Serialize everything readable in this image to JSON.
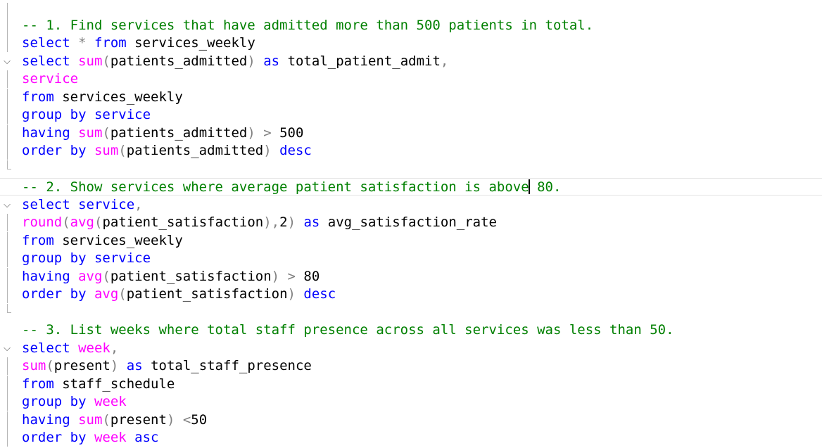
{
  "editor": {
    "colors": {
      "keyword": "#0000ff",
      "function": "#ff00ff",
      "comment": "#008000",
      "operator": "#808080"
    },
    "query1": {
      "comment": "-- 1. Find services that have admitted more than 500 patients in total.",
      "l1": {
        "kw1": "select",
        "op": " * ",
        "kw2": "from",
        "rest": " services_weekly"
      },
      "l2": {
        "kw": "select",
        "fn": "sum",
        "p1": "(",
        "arg": "patients_admitted",
        "p2": ")",
        "kw2": " as",
        "alias": " total_patient_admit",
        "comma": ","
      },
      "l3": {
        "fn": "service"
      },
      "l4": {
        "kw": "from",
        "rest": " services_weekly"
      },
      "l5": {
        "kw": "group by",
        "fn": " service"
      },
      "l6": {
        "kw": "having",
        "fn": " sum",
        "p1": "(",
        "arg": "patients_admitted",
        "p2": ")",
        "op": " > ",
        "num": "500"
      },
      "l7": {
        "kw": "order by",
        "fn": " sum",
        "p1": "(",
        "arg": "patients_admitted",
        "p2": ")",
        "kw2": " desc"
      }
    },
    "query2": {
      "comment_a": "-- 2. Show services where average patient satisfaction is above",
      "comment_b": " 80.",
      "l1": {
        "kw": "select",
        "fn": " service",
        "comma": ","
      },
      "l2": {
        "fn1": "round",
        "p1": "(",
        "fn2": "avg",
        "p2": "(",
        "arg": "patient_satisfaction",
        "p3": "),",
        "num": "2",
        "p4": ")",
        "kw": " as",
        "alias": " avg_satisfaction_rate"
      },
      "l3": {
        "kw": "from",
        "rest": " services_weekly"
      },
      "l4": {
        "kw": "group by",
        "fn": " service"
      },
      "l5": {
        "kw": "having",
        "fn": " avg",
        "p1": "(",
        "arg": "patient_satisfaction",
        "p2": ")",
        "op": " > ",
        "num": "80"
      },
      "l6": {
        "kw": "order by",
        "fn": " avg",
        "p1": "(",
        "arg": "patient_satisfaction",
        "p2": ")",
        "kw2": " desc"
      }
    },
    "query3": {
      "comment": "-- 3. List weeks where total staff presence across all services was less than 50.",
      "l1": {
        "kw": "select",
        "fn": " week",
        "comma": ","
      },
      "l2": {
        "fn": "sum",
        "p1": "(",
        "arg": "present",
        "p2": ")",
        "kw": " as",
        "alias": " total_staff_presence"
      },
      "l3": {
        "kw": "from",
        "rest": " staff_schedule"
      },
      "l4": {
        "kw": "group by",
        "fn": " week"
      },
      "l5": {
        "kw": "having",
        "fn": " sum",
        "p1": "(",
        "arg": "present",
        "p2": ")",
        "op": " <",
        "num": "50"
      },
      "l6": {
        "kw": "order by",
        "fn": " week",
        "kw2": " asc"
      }
    },
    "fold_icon_glyph": "⌵"
  }
}
